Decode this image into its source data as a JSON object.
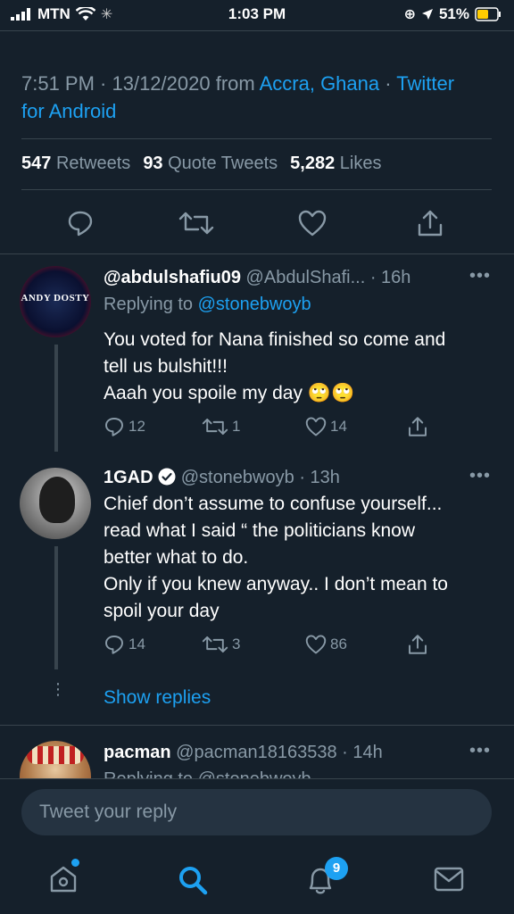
{
  "status_bar": {
    "carrier": "MTN",
    "time": "1:03 PM",
    "battery": "51%"
  },
  "tweet_meta": {
    "time_date": "7:51 PM · 13/12/2020 from ",
    "location": "Accra, Ghana",
    "separator": " · ",
    "client_line1": "Twitter",
    "client_line2": "for Android"
  },
  "stats": {
    "retweets_count": "547",
    "retweets_label": "Retweets",
    "quotes_count": "93",
    "quotes_label": "Quote Tweets",
    "likes_count": "5,282",
    "likes_label": "Likes"
  },
  "replies": [
    {
      "name": "@abdulshafiu09",
      "handle": "@AbdulShafi...",
      "time": "· 16h",
      "replying_prefix": "Replying to ",
      "replying_to": "@stonebwoyb",
      "avatar_text": "ANDY DOSTY",
      "body_line1": "You voted for Nana finished so come and",
      "body_line2": "tell us bulshit!!!",
      "body_line3": "Aaah you spoile my day",
      "emoji": "🙄🙄",
      "reply_count": "12",
      "retweet_count": "1",
      "like_count": "14"
    },
    {
      "name": "1GAD",
      "handle": "@stonebwoyb",
      "time": "· 13h",
      "body_line1": "Chief don’t assume to confuse yourself...",
      "body_line2": "read what I said “ the politicians know",
      "body_line3": "better what to do.",
      "body_line4": "Only if you knew anyway.. I don’t mean to",
      "body_line5": "spoil your day",
      "reply_count": "14",
      "retweet_count": "3",
      "like_count": "86"
    },
    {
      "name": "pacman",
      "handle": "@pacman18163538",
      "time": "· 14h",
      "replying_partial": "Replying to @stonebwoyb"
    }
  ],
  "show_replies": "Show replies",
  "reply_input": {
    "placeholder": "Tweet your reply"
  },
  "tabbar": {
    "notification_count": "9"
  },
  "colors": {
    "background": "#15202b",
    "accent": "#1da1f2",
    "muted": "#8899a6",
    "divider": "#38444d"
  }
}
